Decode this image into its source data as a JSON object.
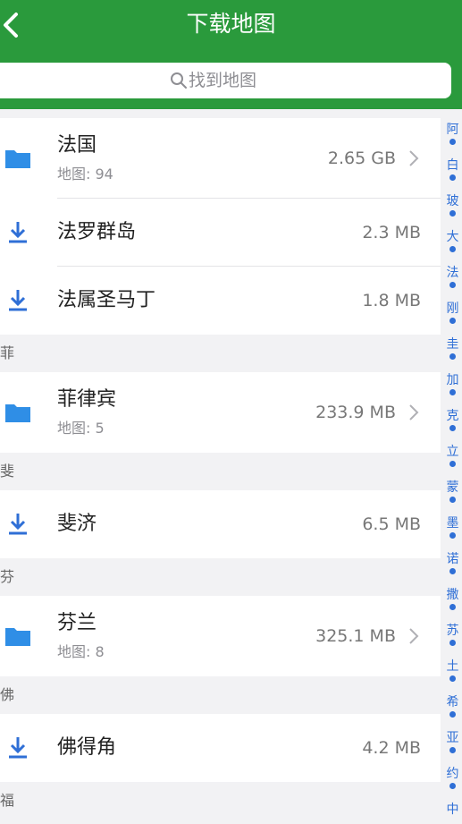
{
  "header": {
    "title": "下载地图"
  },
  "search": {
    "placeholder": "找到地图"
  },
  "rows": [
    {
      "name": "法国",
      "sub": "地图: 94",
      "size": "2.65 GB",
      "kind": "folder"
    },
    {
      "name": "法罗群岛",
      "size": "2.3 MB",
      "kind": "download"
    },
    {
      "name": "法属圣马丁",
      "size": "1.8 MB",
      "kind": "download"
    },
    {
      "section": "菲"
    },
    {
      "name": "菲律宾",
      "sub": "地图: 5",
      "size": "233.9 MB",
      "kind": "folder"
    },
    {
      "section": "斐"
    },
    {
      "name": "斐济",
      "size": "6.5 MB",
      "kind": "download"
    },
    {
      "section": "芬"
    },
    {
      "name": "芬兰",
      "sub": "地图: 8",
      "size": "325.1 MB",
      "kind": "folder"
    },
    {
      "section": "佛"
    },
    {
      "name": "佛得角",
      "size": "4.2 MB",
      "kind": "download"
    },
    {
      "section": "福"
    }
  ],
  "index_letters": [
    "阿",
    "白",
    "玻",
    "大",
    "法",
    "刚",
    "圭",
    "加",
    "克",
    "立",
    "蒙",
    "墨",
    "诺",
    "撒",
    "苏",
    "土",
    "希",
    "亚",
    "约",
    "中"
  ],
  "colors": {
    "header": "#2a9a3c",
    "accent": "#2f6fd6",
    "folder": "#2f8ee6"
  }
}
